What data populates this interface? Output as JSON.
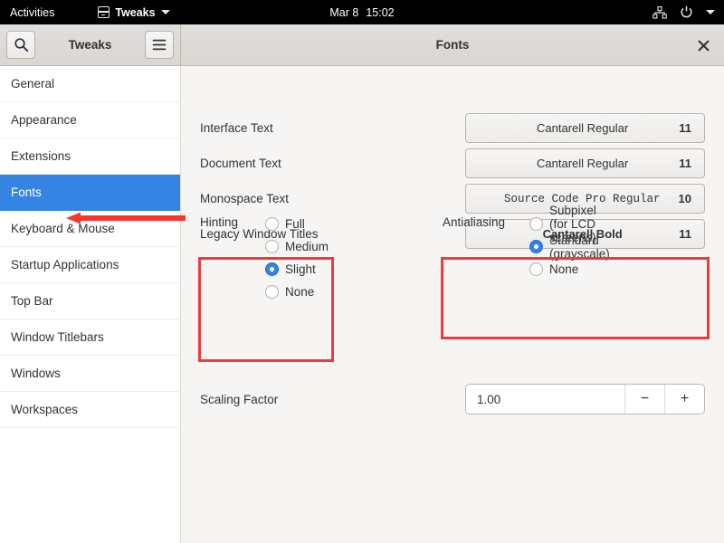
{
  "topbar": {
    "activities": "Activities",
    "app_name": "Tweaks",
    "app_icon": "tweaks-icon",
    "menu_caret": "chevron-down-icon",
    "date": "Mar 8",
    "time": "15:02",
    "network_icon": "network-icon",
    "power_icon": "power-icon",
    "tray_caret": "chevron-down-icon",
    "background": "#000000"
  },
  "headerbar": {
    "search_icon": "search-icon",
    "left_title": "Tweaks",
    "menu_icon": "hamburger-menu-icon",
    "right_title": "Fonts",
    "close_icon": "×"
  },
  "sidebar": {
    "items": [
      {
        "label": "General",
        "selected": false
      },
      {
        "label": "Appearance",
        "selected": false
      },
      {
        "label": "Extensions",
        "selected": false
      },
      {
        "label": "Fonts",
        "selected": true
      },
      {
        "label": "Keyboard & Mouse",
        "selected": false
      },
      {
        "label": "Startup Applications",
        "selected": false
      },
      {
        "label": "Top Bar",
        "selected": false
      },
      {
        "label": "Window Titlebars",
        "selected": false
      },
      {
        "label": "Windows",
        "selected": false
      },
      {
        "label": "Workspaces",
        "selected": false
      }
    ],
    "selected_color": "#3584e4"
  },
  "fonts_page": {
    "font_rows": [
      {
        "label": "Interface Text",
        "font": "Cantarell Regular",
        "size": "11",
        "style": "regular"
      },
      {
        "label": "Document Text",
        "font": "Cantarell Regular",
        "size": "11",
        "style": "regular"
      },
      {
        "label": "Monospace Text",
        "font": "Source Code Pro Regular",
        "size": "10",
        "style": "mono"
      },
      {
        "label": "Legacy Window Titles",
        "font": "Cantarell Bold",
        "size": "11",
        "style": "bold"
      }
    ],
    "hinting": {
      "label": "Hinting",
      "options": [
        {
          "label": "Full",
          "selected": false
        },
        {
          "label": "Medium",
          "selected": false
        },
        {
          "label": "Slight",
          "selected": true
        },
        {
          "label": "None",
          "selected": false
        }
      ]
    },
    "antialiasing": {
      "label": "Antialiasing",
      "options": [
        {
          "label": "Subpixel (for LCD screens)",
          "selected": false
        },
        {
          "label": "Standard (grayscale)",
          "selected": true
        },
        {
          "label": "None",
          "selected": false
        }
      ]
    },
    "scaling": {
      "label": "Scaling Factor",
      "value": "1.00",
      "decrement_label": "−",
      "increment_label": "+"
    }
  },
  "annotations": {
    "color": "#f03a3a",
    "arrow_target": "Fonts",
    "boxed_groups": [
      "Hinting",
      "Antialiasing"
    ]
  }
}
